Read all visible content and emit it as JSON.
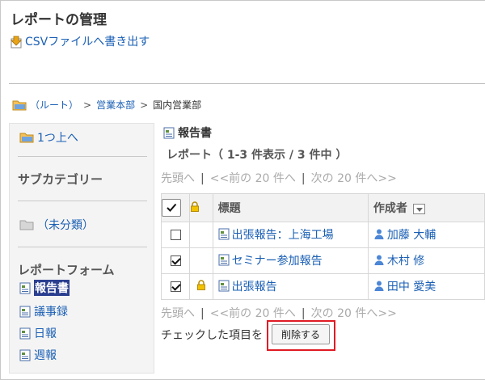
{
  "page": {
    "title": "レポートの管理",
    "csv_export_label": "CSVファイルへ書き出す"
  },
  "breadcrumb": {
    "root": "（ルート）",
    "level1": "営業本部",
    "current": "国内営業部",
    "separator": ">"
  },
  "sidebar": {
    "up_label": "1つ上へ",
    "subcategory_heading": "サブカテゴリー",
    "uncategorized_label": "（未分類）",
    "report_form_heading": "レポートフォーム",
    "forms": [
      "報告書",
      "議事録",
      "日報",
      "週報"
    ],
    "active_form_index": 0
  },
  "main": {
    "form_label": "報告書",
    "count_text": "レポート（ 1-3 件表示 / 3 件中 ）",
    "pager": {
      "first": "先頭へ",
      "prev": "<<前の 20 件へ",
      "next": "次の 20 件へ>>",
      "pipe": "|"
    },
    "table": {
      "columns": [
        "標題",
        "作成者"
      ],
      "rows": [
        {
          "title": "出張報告：上海工場",
          "author": "加藤 大輔",
          "checked": false,
          "locked": false
        },
        {
          "title": "セミナー参加報告",
          "author": "木村 修",
          "checked": true,
          "locked": false
        },
        {
          "title": "出張報告",
          "author": "田中 愛美",
          "checked": true,
          "locked": true
        }
      ]
    },
    "bulk_action_label": "チェックした項目を",
    "delete_button_label": "削除する"
  },
  "colors": {
    "link": "#1a5fb4",
    "highlight": "#e01b24",
    "active_form_bg": "#2a3f8f"
  }
}
